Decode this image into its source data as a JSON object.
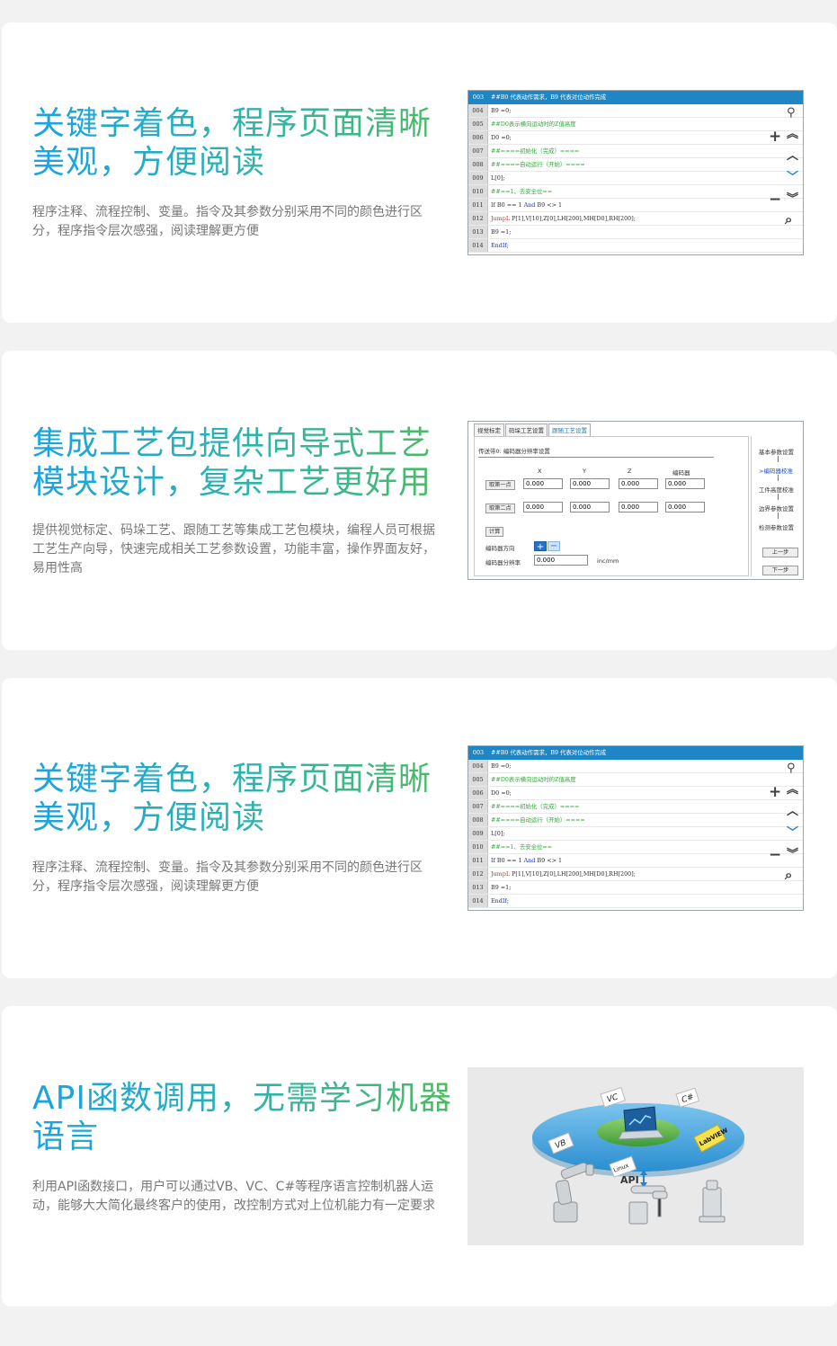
{
  "sections": [
    {
      "title": "关键字着色，程序页面清晰美观，方便阅读",
      "desc": "程序注释、流程控制、变量。指令及其参数分别采用不同的颜色进行区分，程序指令层次感强，阅读理解更方便"
    },
    {
      "title": "集成工艺包提供向导式工艺模块设计，复杂工艺更好用",
      "desc": "提供视觉标定、码垛工艺、跟随工艺等集成工艺包模块，编程人员可根据工艺生产向导，快速完成相关工艺参数设置，功能丰富，操作界面友好，易用性高"
    },
    {
      "title": "关键字着色，程序页面清晰美观，方便阅读",
      "desc": "程序注释、流程控制、变量。指令及其参数分别采用不同的颜色进行区分，程序指令层次感强，阅读理解更方便"
    },
    {
      "title": "API函数调用，无需学习机器语言",
      "desc": "利用API函数接口，用户可以通过VB、VC、C#等程序语言控制机器人运动，能够大大简化最终客户的使用，改控制方式对上位机能力有一定要求"
    }
  ],
  "code_editor": {
    "lines": [
      {
        "n": "003",
        "t": "##B0 代表动作需求，B9 代表对位动作完成"
      },
      {
        "n": "004",
        "t": "B9 =0;"
      },
      {
        "n": "005",
        "t": "##D0表示横向运动时的Z值高度"
      },
      {
        "n": "006",
        "t": "D0 =0;"
      },
      {
        "n": "007",
        "t": "##====初始化（完成）===="
      },
      {
        "n": "008",
        "t": "##====自动运行（开始）===="
      },
      {
        "n": "009",
        "t": "L[0];"
      },
      {
        "n": "010",
        "t": "##==1、去安全位=="
      },
      {
        "n": "011",
        "t": "If B0 == 1 And B9 <> 1"
      },
      {
        "n": "012",
        "t": "JumpL P[1],V[10],Z[0],LH[200],MH[D0],RH[200];"
      },
      {
        "n": "013",
        "t": "B9 =1;"
      },
      {
        "n": "014",
        "t": "EndIf;"
      }
    ],
    "side_icons": [
      "location-icon",
      "plus-icon",
      "double-up-icon",
      "up-icon",
      "down-icon",
      "minus-icon",
      "double-down-icon",
      "search-icon"
    ],
    "accent": "#1e86c4"
  },
  "wizard": {
    "tabs": [
      "视觉标定",
      "码垛工艺设置",
      "跟随工艺设置"
    ],
    "heading": "传送带0: 编码器分辨率设置",
    "cols": [
      "X",
      "Y",
      "Z",
      "编码器"
    ],
    "row1_btn": "取第一点",
    "row2_btn": "取第二点",
    "row1": [
      "0.000",
      "0.000",
      "0.000",
      "0.000"
    ],
    "row2": [
      "0.000",
      "0.000",
      "0.000",
      "0.000"
    ],
    "calc": "计算",
    "dir_label": "编码器方向",
    "res_label": "编码器分辨率",
    "res_value": "0.000",
    "unit": "inc/mm",
    "steps": [
      "基本参数设置",
      ">编码器校准",
      "工件高度校准",
      "边界参数设置",
      "检测参数设置"
    ],
    "prev": "上一步",
    "next": "下一步"
  },
  "api_diagram": {
    "labels": [
      "VC",
      "C#",
      "VB",
      "LabVIEW",
      "Linux",
      "API"
    ]
  }
}
